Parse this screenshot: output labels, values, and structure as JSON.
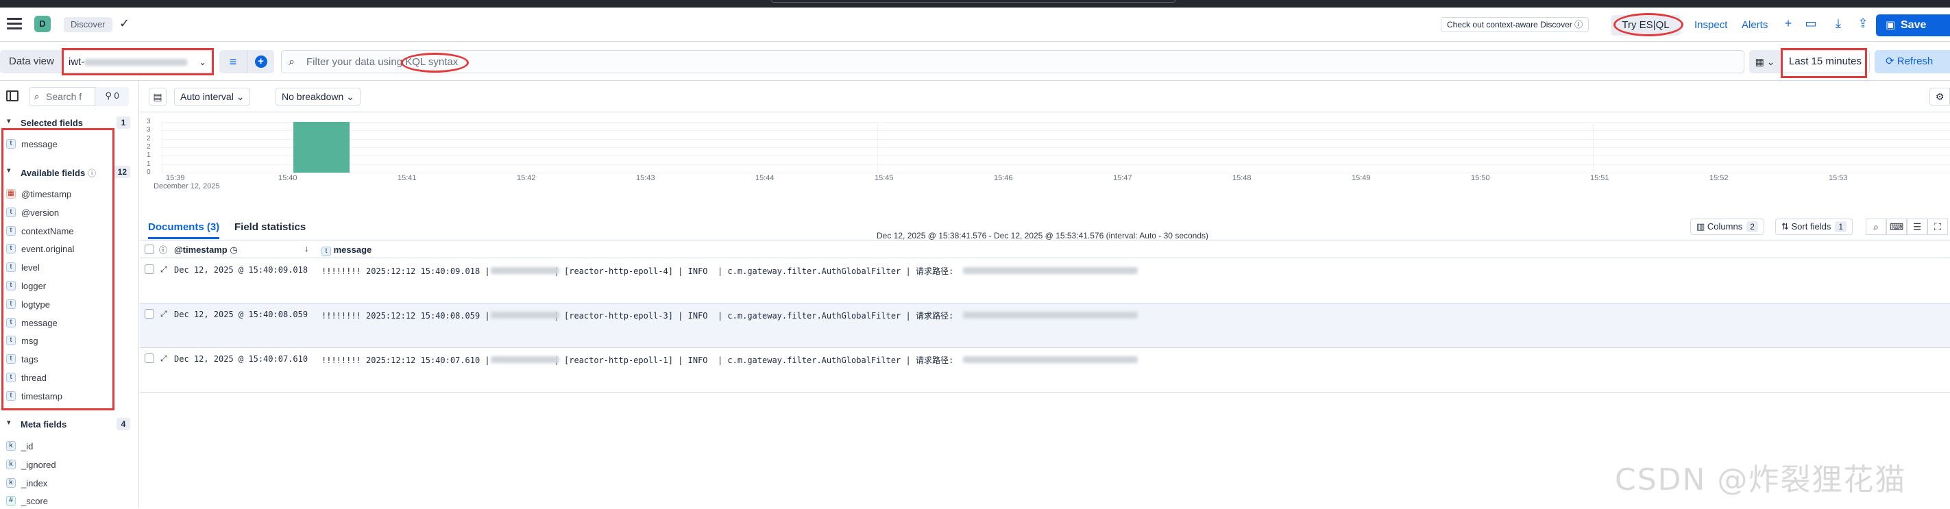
{
  "header": {
    "space_initial": "D",
    "breadcrumb": "Discover",
    "context_link": "Check out context-aware Discover ⓘ",
    "esql": "Try ES|QL",
    "inspect": "Inspect",
    "alerts": "Alerts",
    "save": "Save"
  },
  "querybar": {
    "data_view_label": "Data view",
    "data_view_value": "iwt-",
    "kql_placeholder": "Filter your data using KQL syntax",
    "time_range": "Last 15 minutes",
    "refresh": "Refresh"
  },
  "sidebar": {
    "search_placeholder": "Search f",
    "filter_count": "0",
    "selected_title": "Selected fields",
    "selected_count": "1",
    "selected": [
      {
        "type": "t",
        "name": "message"
      }
    ],
    "available_title": "Available fields",
    "available_count": "12",
    "available": [
      {
        "type": "date",
        "name": "@timestamp"
      },
      {
        "type": "t",
        "name": "@version"
      },
      {
        "type": "t",
        "name": "contextName"
      },
      {
        "type": "t",
        "name": "event.original"
      },
      {
        "type": "t",
        "name": "level"
      },
      {
        "type": "t",
        "name": "logger"
      },
      {
        "type": "t",
        "name": "logtype"
      },
      {
        "type": "t",
        "name": "message"
      },
      {
        "type": "t",
        "name": "msg"
      },
      {
        "type": "t",
        "name": "tags"
      },
      {
        "type": "t",
        "name": "thread"
      },
      {
        "type": "t",
        "name": "timestamp"
      }
    ],
    "meta_title": "Meta fields",
    "meta_count": "4",
    "meta": [
      {
        "type": "k",
        "name": "_id"
      },
      {
        "type": "k",
        "name": "_ignored"
      },
      {
        "type": "k",
        "name": "_index"
      },
      {
        "type": "#",
        "name": "_score"
      }
    ]
  },
  "toolbar": {
    "interval": "Auto interval",
    "breakdown": "No breakdown"
  },
  "chart_data": {
    "type": "bar",
    "y_ticks": [
      "3",
      "3",
      "2",
      "2",
      "1",
      "1",
      "0"
    ],
    "x_ticks": [
      "15:39",
      "15:40",
      "15:41",
      "15:42",
      "15:43",
      "15:44",
      "15:45",
      "15:46",
      "15:47",
      "15:48",
      "15:49",
      "15:50",
      "15:51",
      "15:52",
      "15:53"
    ],
    "x_date_label": "December 12, 2025",
    "bars": [
      {
        "x": "15:40",
        "value": 3
      }
    ],
    "ylim": [
      0,
      3
    ],
    "range_text": "Dec 12, 2025 @ 15:38:41.576 - Dec 12, 2025 @ 15:53:41.576 (interval: Auto - 30 seconds)"
  },
  "tabs": {
    "documents": "Documents (3)",
    "field_stats": "Field statistics",
    "columns": "Columns",
    "columns_count": "2",
    "sort": "Sort fields",
    "sort_count": "1"
  },
  "grid": {
    "col_timestamp": "@timestamp",
    "col_message": "message",
    "rows": [
      {
        "ts": "Dec 12, 2025 @ 15:40:09.018",
        "msg": "!!!!!!!! 2025:12:12 15:40:09.018 |             | [reactor-http-epoll-4] | INFO  | c.m.gateway.filter.AuthGlobalFilter | 请求路径:"
      },
      {
        "ts": "Dec 12, 2025 @ 15:40:08.059",
        "msg": "!!!!!!!! 2025:12:12 15:40:08.059 |             | [reactor-http-epoll-3] | INFO  | c.m.gateway.filter.AuthGlobalFilter | 请求路径:"
      },
      {
        "ts": "Dec 12, 2025 @ 15:40:07.610",
        "msg": "!!!!!!!! 2025:12:12 15:40:07.610 |             | [reactor-http-epoll-1] | INFO  | c.m.gateway.filter.AuthGlobalFilter | 请求路径:"
      }
    ]
  },
  "watermark": "CSDN @炸裂狸花猫",
  "colors": {
    "accent": "#0b64dd",
    "bar": "#54b399",
    "annotation": "#e23b3b"
  }
}
